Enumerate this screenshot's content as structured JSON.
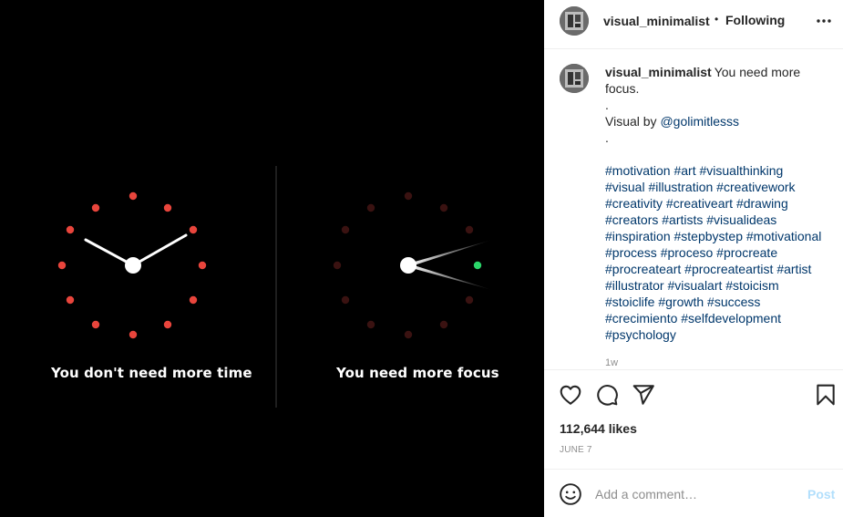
{
  "media": {
    "caption_left": "You don't need more time",
    "caption_right": "You need more focus",
    "colors": {
      "dot_red": "#e8453c",
      "dot_dim": "#3a1211",
      "dot_green": "#2bd66a",
      "background": "#000000"
    }
  },
  "header": {
    "username": "visual_minimalist",
    "separator": "•",
    "following": "Following",
    "more_icon": "more-horizontal-icon"
  },
  "post": {
    "username": "visual_minimalist",
    "caption_lines": [
      "You need more focus.",
      ".",
      "Visual by",
      ".",
      "",
      "#motivation #art #visualthinking",
      "#visual #illustration #creativework",
      "#creativity #creativeart #drawing",
      "#creators #artists #visualideas",
      "#inspiration #stepbystep #motivational",
      "#process #proceso #procreate",
      "#procreateart #procreateartist #artist",
      "#illustrator #visualart #stoicism",
      "#stoiclife #growth #success",
      "#crecimiento #selfdevelopment",
      "#psychology"
    ],
    "mention": "@golimitlesss",
    "time_ago": "1w"
  },
  "actions": {
    "like_icon": "heart-icon",
    "comment_icon": "comment-icon",
    "share_icon": "send-icon",
    "save_icon": "bookmark-icon",
    "likes": "112,644 likes",
    "date": "JUNE 7"
  },
  "comment_box": {
    "emoji_icon": "emoji-icon",
    "placeholder": "Add a comment…",
    "post_label": "Post"
  },
  "colors": {
    "link": "#00376b",
    "muted": "#8e8e8e",
    "post_disabled": "#b2dffc"
  }
}
